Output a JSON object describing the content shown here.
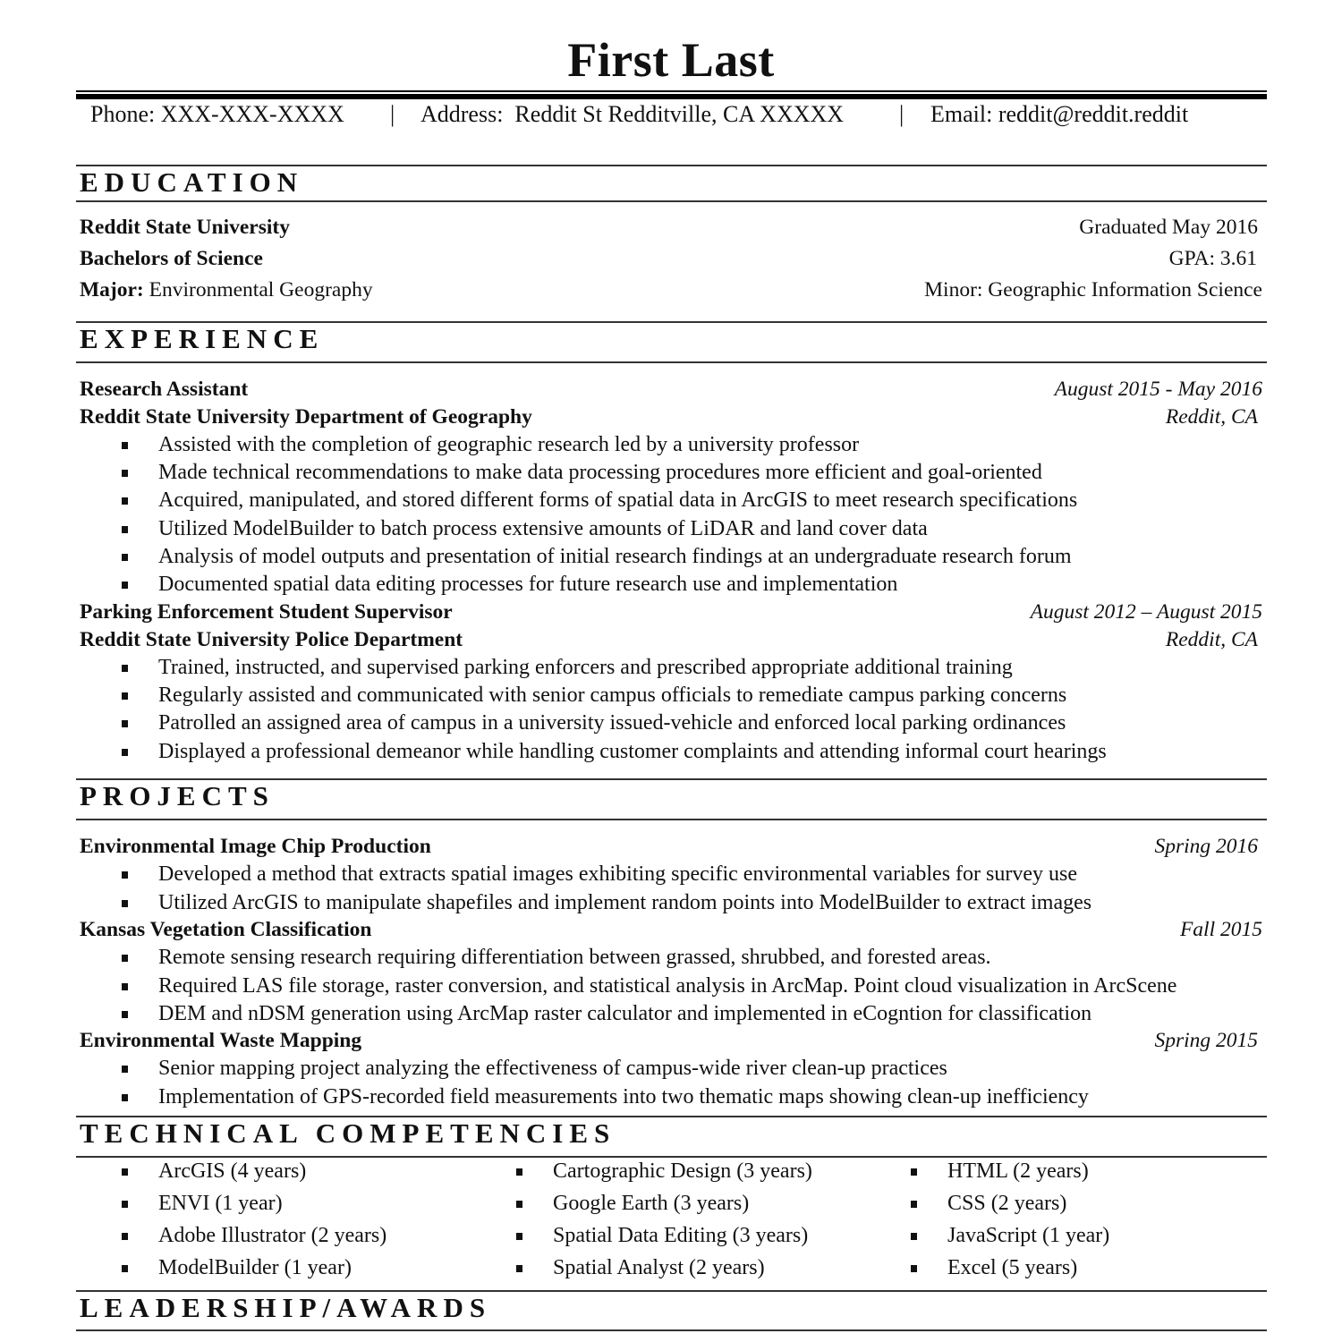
{
  "header": {
    "name": "First Last",
    "phone": "Phone: XXX-XXX-XXXX",
    "separator": "|",
    "address": "Address:  Reddit St Redditville, CA XXXXX",
    "email": "Email: reddit@reddit.reddit"
  },
  "education": {
    "heading": "EDUCATION",
    "school": "Reddit State University",
    "graduated": "Graduated May 2016",
    "degree": "Bachelors of Science",
    "gpa": "GPA: 3.61",
    "major_label": "Major:",
    "major": " Environmental Geography",
    "minor": "Minor: Geographic Information Science"
  },
  "experience": {
    "heading": "EXPERIENCE",
    "jobs": [
      {
        "title": "Research Assistant",
        "dates": "August 2015 - May 2016",
        "org": "Reddit State University Department of Geography",
        "location": "Reddit, CA",
        "bullets": [
          "Assisted with the completion of geographic research led by a university professor",
          "Made technical recommendations to make data processing procedures more efficient and goal-oriented",
          "Acquired, manipulated, and stored different forms of spatial data in ArcGIS to meet research specifications",
          "Utilized ModelBuilder to batch process extensive amounts of LiDAR and land cover data",
          "Analysis of model outputs and presentation of initial research findings at an undergraduate research forum",
          "Documented spatial data editing processes for future research use and implementation"
        ]
      },
      {
        "title": "Parking Enforcement Student Supervisor",
        "dates": "August 2012 – August 2015",
        "org": "Reddit State University Police Department",
        "location": "Reddit, CA",
        "bullets": [
          "Trained, instructed, and supervised parking enforcers and prescribed appropriate additional training",
          "Regularly assisted and communicated with senior campus officials to remediate campus parking concerns",
          "Patrolled an assigned area of campus in a university issued-vehicle and enforced local parking ordinances",
          "Displayed a professional demeanor while handling customer complaints and attending informal court hearings"
        ]
      }
    ]
  },
  "projects": {
    "heading": "PROJECTS",
    "items": [
      {
        "title": "Environmental Image Chip Production",
        "date": "Spring 2016",
        "bullets": [
          "Developed a method that extracts spatial images exhibiting specific environmental variables for survey use",
          "Utilized ArcGIS to manipulate shapefiles and implement random points into ModelBuilder to extract images"
        ]
      },
      {
        "title": "Kansas Vegetation Classification",
        "date": "Fall 2015",
        "bullets": [
          "Remote sensing research requiring differentiation between grassed, shrubbed, and forested areas.",
          "Required LAS file storage, raster conversion, and statistical analysis in ArcMap. Point cloud visualization in ArcScene",
          "DEM and nDSM generation using ArcMap raster calculator and implemented in eCogntion for classification"
        ]
      },
      {
        "title": "Environmental Waste Mapping",
        "date": "Spring 2015",
        "bullets": [
          "Senior mapping project analyzing the effectiveness of campus-wide river clean-up practices",
          "Implementation of GPS-recorded field measurements into two thematic maps showing clean-up inefficiency"
        ]
      }
    ]
  },
  "skills": {
    "heading": "TECHNICAL COMPETENCIES",
    "columns": [
      [
        "ArcGIS (4 years)",
        "ENVI (1 year)",
        "Adobe Illustrator (2 years)",
        "ModelBuilder (1 year)"
      ],
      [
        "Cartographic Design (3 years)",
        "Google Earth (3 years)",
        "Spatial Data Editing (3 years)",
        "Spatial Analyst (2 years)"
      ],
      [
        "HTML (2 years)",
        "CSS (2 years)",
        "JavaScript (1 year)",
        "Excel (5 years)"
      ]
    ]
  },
  "leadership": {
    "heading": "LEADERSHIP/AWARDS"
  }
}
